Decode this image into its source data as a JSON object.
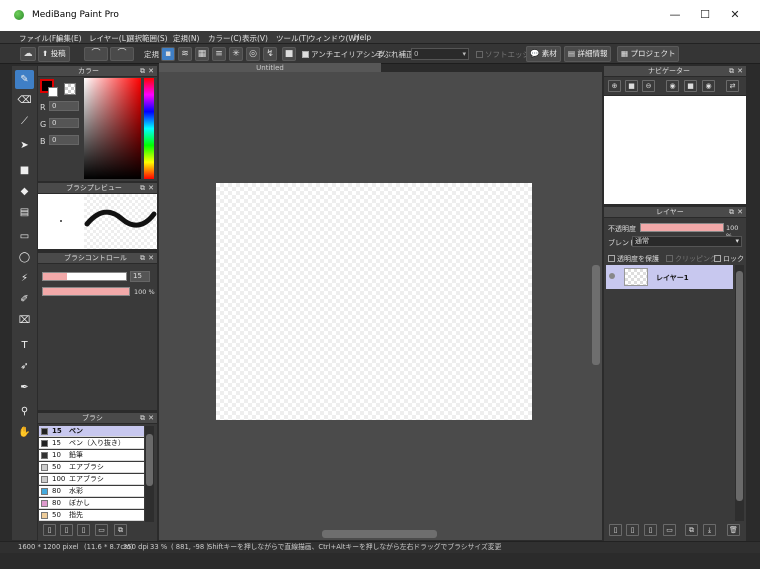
{
  "window": {
    "title": "MediBang Paint Pro",
    "minimize": "—",
    "maximize": "☐",
    "close": "✕"
  },
  "menu": [
    "ファイル(F)",
    "編集(E)",
    "レイヤー(L)",
    "選択範囲(S)",
    "定規(N)",
    "カラー(C)",
    "表示(V)",
    "ツール(T)",
    "ウィンドウ(W)",
    "Help"
  ],
  "toolbar": {
    "post_label": "投稿",
    "ruler_label": "定規",
    "antialias_label": "アンチエイリアシング",
    "stabilizer_label": "手ぶれ補正",
    "stabilizer_value": "0",
    "softedge_label": "ソフトエッジ",
    "material_label": "素材",
    "detail_label": "詳細情報",
    "project_label": "プロジェクト"
  },
  "canvas": {
    "tab_title": "Untitled"
  },
  "color_panel": {
    "title": "カラー",
    "r_label": "R",
    "g_label": "G",
    "b_label": "B",
    "r_value": "0",
    "g_value": "0",
    "b_value": "0"
  },
  "brush_preview": {
    "title": "ブラシプレビュー"
  },
  "brush_control": {
    "title": "ブラシコントロール",
    "size_value": "15",
    "opacity_value": "100 %"
  },
  "brush_panel": {
    "title": "ブラシ",
    "items": [
      {
        "size": "15",
        "name": "ペン",
        "color": "#222222"
      },
      {
        "size": "15",
        "name": "ペン（入り抜き）",
        "color": "#222222"
      },
      {
        "size": "10",
        "name": "鉛筆",
        "color": "#333333"
      },
      {
        "size": "50",
        "name": "エアブラシ",
        "color": "#cccccc"
      },
      {
        "size": "100",
        "name": "エアブラシ",
        "color": "#cccccc"
      },
      {
        "size": "80",
        "name": "水彩",
        "color": "#44aadd"
      },
      {
        "size": "80",
        "name": "ぼかし",
        "color": "#dd99cc"
      },
      {
        "size": "50",
        "name": "指先",
        "color": "#eecc99"
      }
    ]
  },
  "navigator": {
    "title": "ナビゲーター"
  },
  "layer_panel": {
    "title": "レイヤー",
    "opacity_label": "不透明度",
    "opacity_value": "100 %",
    "blend_label": "ブレンド",
    "blend_value": "通常",
    "protect_label": "透明度を保護",
    "clipping_label": "クリッピング",
    "lock_label": "ロック",
    "layer_name": "レイヤー1"
  },
  "status": {
    "size": "1600 * 1200 pixel",
    "physical": "(11.6 * 8.7cm)",
    "dpi": "350 dpi",
    "zoom": "33 %",
    "coords": "( 881, -98 )",
    "hint": "Shiftキーを押しながらで直線描画、Ctrl+Altキーを押しながら左右ドラッグでブラシサイズ変更"
  },
  "colors": {
    "accent": "#3f7fc6",
    "selected_row": "#c8c8ef",
    "brush_size_bar": "#f2a9a9"
  }
}
